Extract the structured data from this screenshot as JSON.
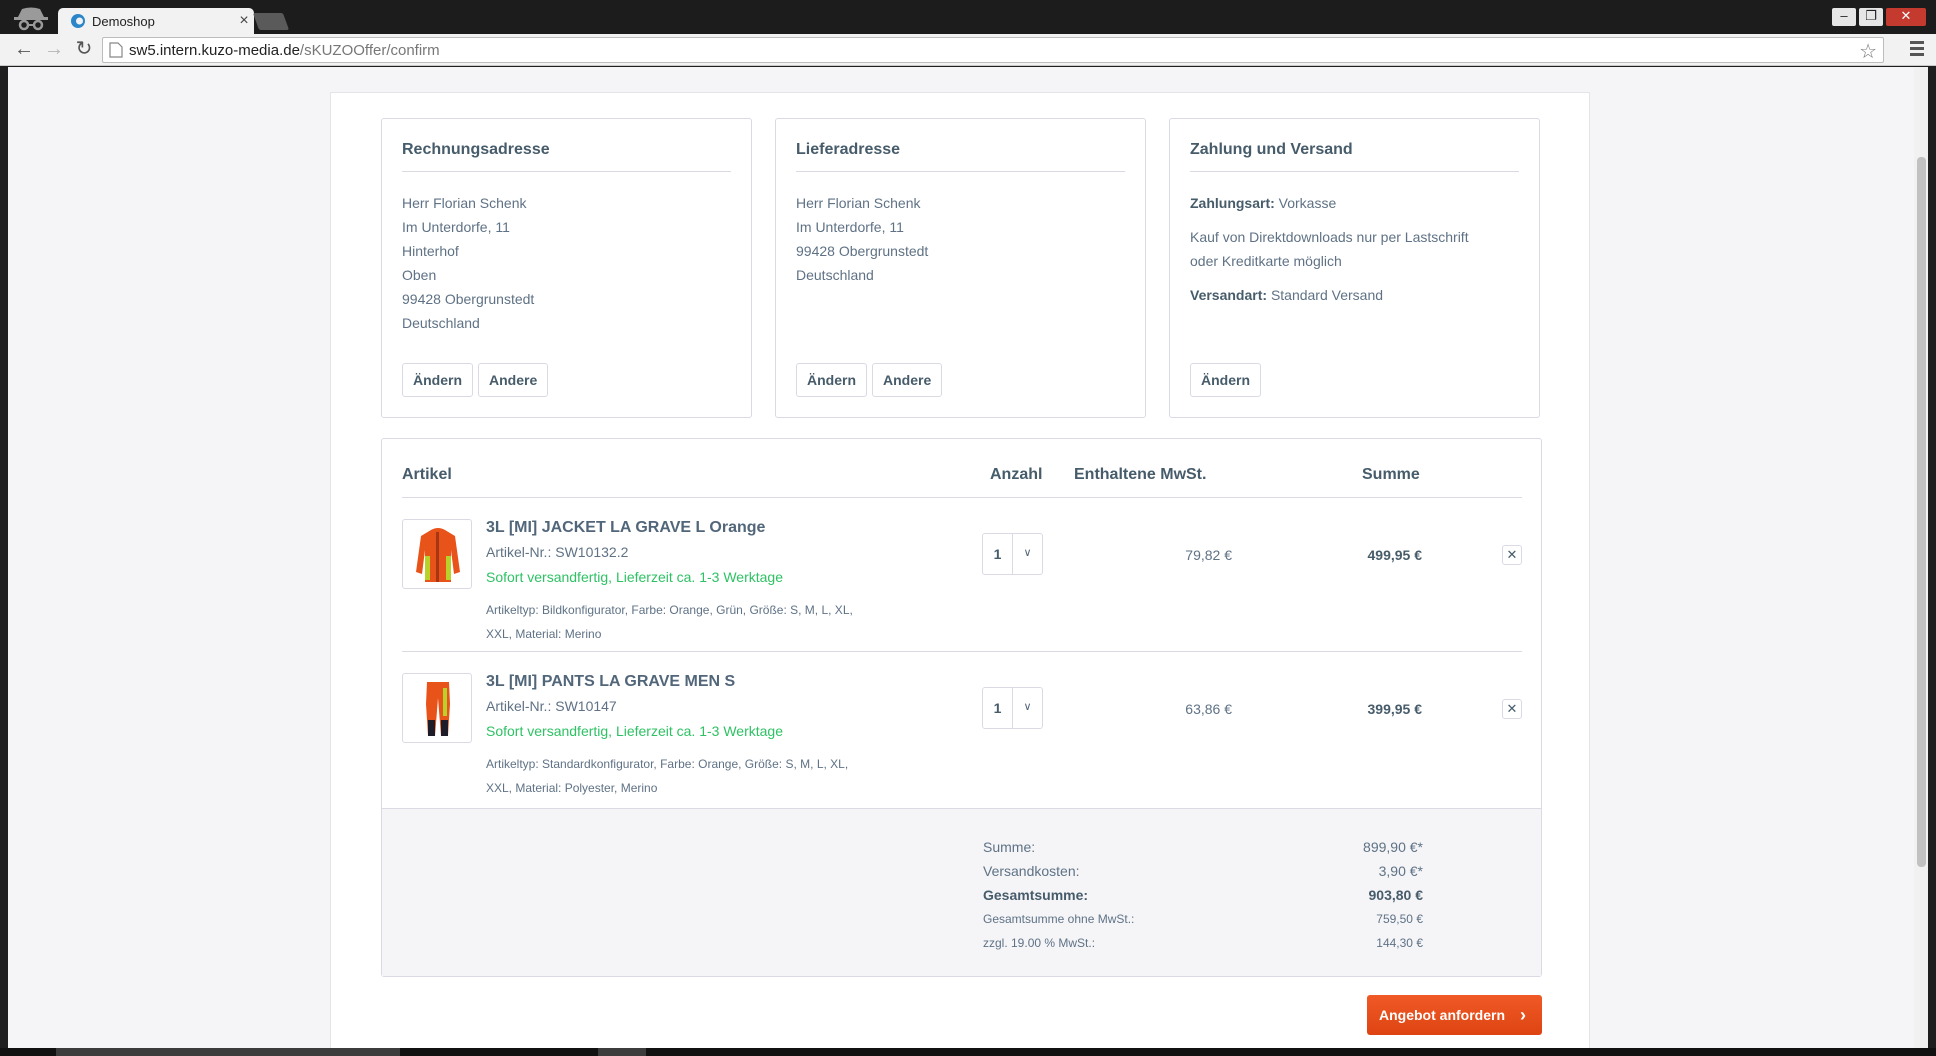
{
  "browser": {
    "tab_title": "Demoshop",
    "tab_close": "×",
    "url_host": "sw5.intern.kuzo-media.de",
    "url_path": "/sKUZOOffer/confirm",
    "win_min": "–",
    "win_restore": "❐",
    "win_close": "✕"
  },
  "billing": {
    "title": "Rechnungsadresse",
    "lines": [
      "Herr Florian Schenk",
      "Im Unterdorfe, 11",
      "Hinterhof",
      "Oben",
      "99428 Obergrunstedt",
      "Deutschland"
    ],
    "change_label": "Ändern",
    "other_label": "Andere"
  },
  "shipping": {
    "title": "Lieferadresse",
    "lines": [
      "Herr Florian Schenk",
      "Im Unterdorfe, 11",
      "99428 Obergrunstedt",
      "Deutschland"
    ],
    "change_label": "Ändern",
    "other_label": "Andere"
  },
  "payment": {
    "title": "Zahlung und Versand",
    "payment_label": "Zahlungsart:",
    "payment_value": "Vorkasse",
    "note_line1": "Kauf von Direktdownloads nur per Lastschrift",
    "note_line2": "oder Kreditkarte möglich",
    "shipping_label": "Versandart:",
    "shipping_value": "Standard Versand",
    "change_label": "Ändern"
  },
  "cart": {
    "headers": {
      "article": "Artikel",
      "quantity": "Anzahl",
      "vat": "Enthaltene MwSt.",
      "sum": "Summe"
    },
    "items": [
      {
        "name": "3L [MI] JACKET LA GRAVE L Orange",
        "sku": "Artikel-Nr.: SW10132.2",
        "delivery": "Sofort versandfertig, Lieferzeit ca. 1-3 Werktage",
        "attrs": "Artikeltyp: Bildkonfigurator, Farbe: Orange, Grün, Größe: S, M, L, XL, XXL, Material: Merino",
        "quantity": "1",
        "vat": "79,82 €",
        "sum": "499,95 €",
        "remove": "✕"
      },
      {
        "name": "3L [MI] PANTS LA GRAVE MEN S",
        "sku": "Artikel-Nr.: SW10147",
        "delivery": "Sofort versandfertig, Lieferzeit ca. 1-3 Werktage",
        "attrs": "Artikeltyp: Standardkonfigurator, Farbe: Orange, Größe: S, M, L, XL, XXL, Material: Polyester, Merino",
        "quantity": "1",
        "vat": "63,86 €",
        "sum": "399,95 €",
        "remove": "✕"
      }
    ],
    "totals": {
      "subtotal_label": "Summe:",
      "subtotal_value": "899,90 €*",
      "shipping_label": "Versandkosten:",
      "shipping_value": "3,90 €*",
      "grand_label": "Gesamtsumme:",
      "grand_value": "903,80 €",
      "net_label": "Gesamtsumme ohne MwSt.:",
      "net_value": "759,50 €",
      "tax_label": "zzgl. 19.00 % MwSt.:",
      "tax_value": "144,30 €"
    }
  },
  "cta": {
    "label": "Angebot anfordern",
    "arrow": "›"
  },
  "colors": {
    "accent": "#e74c1a",
    "delivery_green": "#2ec264",
    "text": "#52667a",
    "border": "#dadae5"
  },
  "icons": [
    "incognito-icon",
    "chrome-favicon",
    "back-icon",
    "forward-icon",
    "reload-icon",
    "page-icon",
    "star-icon",
    "menu-icon",
    "chevron-down-icon",
    "close-icon",
    "chevron-right-icon"
  ]
}
